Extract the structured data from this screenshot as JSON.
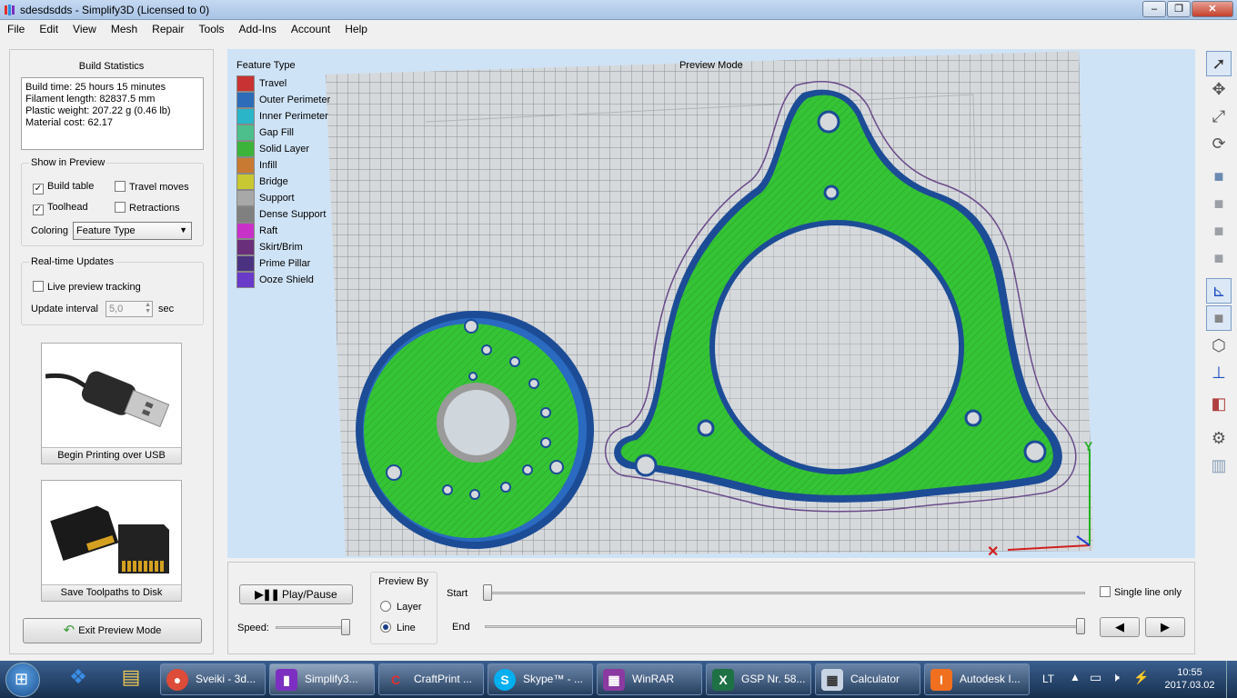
{
  "window": {
    "title": "sdesdsdds - Simplify3D (Licensed to 0)"
  },
  "menu": [
    "File",
    "Edit",
    "View",
    "Mesh",
    "Repair",
    "Tools",
    "Add-Ins",
    "Account",
    "Help"
  ],
  "build_stats": {
    "title": "Build Statistics",
    "lines": [
      "Build time: 25 hours 15 minutes",
      "Filament length: 82837.5 mm",
      "Plastic weight: 207.22 g (0.46 lb)",
      "Material cost: 62.17"
    ]
  },
  "show_preview": {
    "title": "Show in Preview",
    "build_table": "Build table",
    "travel_moves": "Travel moves",
    "toolhead": "Toolhead",
    "retractions": "Retractions",
    "coloring_label": "Coloring",
    "coloring_value": "Feature Type"
  },
  "realtime": {
    "title": "Real-time Updates",
    "live_tracking": "Live preview tracking",
    "interval_label": "Update interval",
    "interval_value": "5,0",
    "interval_unit": "sec"
  },
  "actions": {
    "usb": "Begin Printing over USB",
    "disk": "Save Toolpaths to Disk",
    "exit": "Exit Preview Mode"
  },
  "viewport": {
    "legend_title": "Feature Type",
    "mode_label": "Preview Mode",
    "legend": [
      {
        "label": "Travel",
        "color": "#c83232"
      },
      {
        "label": "Outer Perimeter",
        "color": "#2c6cb8"
      },
      {
        "label": "Inner Perimeter",
        "color": "#2bb5c8"
      },
      {
        "label": "Gap Fill",
        "color": "#4cbf8c"
      },
      {
        "label": "Solid Layer",
        "color": "#3cb43c"
      },
      {
        "label": "Infill",
        "color": "#c87a32"
      },
      {
        "label": "Bridge",
        "color": "#c8c832"
      },
      {
        "label": "Support",
        "color": "#a8a8a8"
      },
      {
        "label": "Dense Support",
        "color": "#808080"
      },
      {
        "label": "Raft",
        "color": "#c832c8"
      },
      {
        "label": "Skirt/Brim",
        "color": "#6a2f7a"
      },
      {
        "label": "Prime Pillar",
        "color": "#4a3280"
      },
      {
        "label": "Ooze Shield",
        "color": "#6a3ac8"
      }
    ]
  },
  "playback": {
    "play_pause": "Play/Pause",
    "speed_label": "Speed:",
    "preview_by": "Preview By",
    "layer": "Layer",
    "line": "Line",
    "start_label": "Start",
    "end_label": "End",
    "single_line": "Single line only"
  },
  "taskbar": {
    "items": [
      "Sveiki - 3d...",
      "Simplify3...",
      "CraftPrint ...",
      "Skype™ - ...",
      "WinRAR",
      "GSP Nr. 58...",
      "Calculator",
      "Autodesk I..."
    ],
    "lang": "LT",
    "time": "10:55",
    "date": "2017.03.02"
  },
  "colors": {
    "accent_green": "#3cc03c",
    "perimeter_blue": "#2a60b0",
    "viewport_bg": "#cfe3f6"
  }
}
